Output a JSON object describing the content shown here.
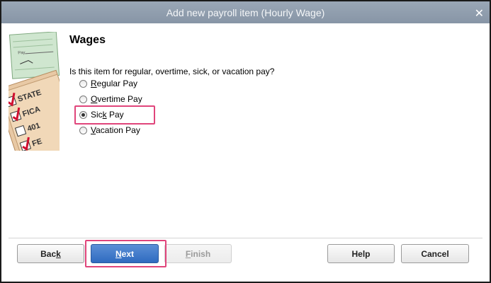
{
  "window": {
    "title": "Add new payroll item (Hourly Wage)",
    "close_glyph": "✕"
  },
  "page": {
    "heading": "Wages",
    "question": "Is this item for regular, overtime, sick, or vacation pay?"
  },
  "options": [
    {
      "pre": "",
      "key": "R",
      "post": "egular Pay",
      "selected": false
    },
    {
      "pre": "",
      "key": "O",
      "post": "vertime Pay",
      "selected": false
    },
    {
      "pre": "Sic",
      "key": "k",
      "post": " Pay",
      "selected": true
    },
    {
      "pre": "",
      "key": "V",
      "post": "acation Pay",
      "selected": false
    }
  ],
  "side_image": {
    "check_labels": [
      "STATE",
      "FICA",
      "401",
      "FE"
    ],
    "check_line_label": "Pay"
  },
  "buttons": {
    "back": {
      "pre": "Bac",
      "key": "k",
      "post": ""
    },
    "next": {
      "pre": "",
      "key": "N",
      "post": "ext"
    },
    "finish": {
      "pre": "",
      "key": "F",
      "post": "inish"
    },
    "help": "Help",
    "cancel": "Cancel"
  },
  "colors": {
    "highlight": "#e0457b",
    "primary_button": "#2f6bc0",
    "titlebar": "#8f9cad"
  }
}
